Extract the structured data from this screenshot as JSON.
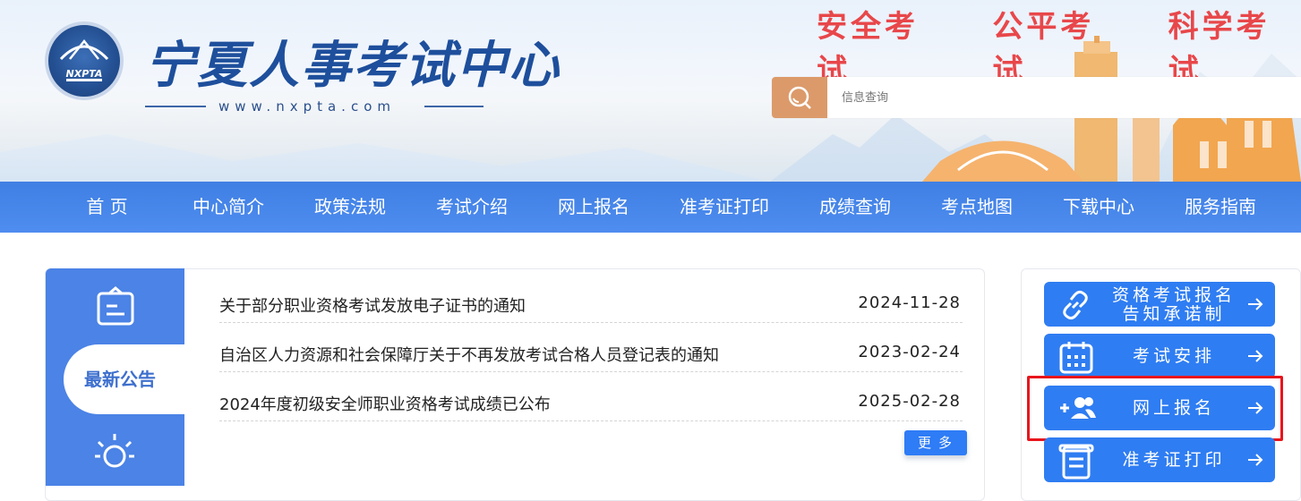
{
  "header": {
    "site_title": "宁夏人事考试中心",
    "logo_text": "NXPTA",
    "url": "www.nxpta.com",
    "slogans": [
      "安全考试",
      "公平考试",
      "科学考试"
    ],
    "search_placeholder": "信息查询",
    "search_icon": "search-icon"
  },
  "nav": {
    "items": [
      "首 页",
      "中心简介",
      "政策法规",
      "考试介绍",
      "网上报名",
      "准考证打印",
      "成绩查询",
      "考点地图",
      "下载中心",
      "服务指南"
    ]
  },
  "announcements": {
    "tab_active_label": "最新公告",
    "tab_icons": [
      "notice-board-icon",
      "lightbulb-icon"
    ],
    "items": [
      {
        "title": "关于部分职业资格考试发放电子证书的通知",
        "date": "2024-11-28"
      },
      {
        "title": "自治区人力资源和社会保障厅关于不再发放考试合格人员登记表的通知",
        "date": "2023-02-24"
      },
      {
        "title": "2024年度初级安全师职业资格考试成绩已公布",
        "date": "2025-02-28"
      }
    ],
    "more_label": "更多"
  },
  "quick_links": [
    {
      "line1": "资格考试报名",
      "line2": "告知承诺制",
      "icon": "link-icon"
    },
    {
      "line1": "考试安排",
      "icon": "calendar-icon"
    },
    {
      "line1": "网上报名",
      "icon": "add-user-icon"
    },
    {
      "line1": "准考证打印",
      "icon": "document-icon"
    }
  ],
  "colors": {
    "nav_blue": "#4a88ec",
    "slogan_red": "#e8474a",
    "button_blue": "#2f7df2",
    "search_orange": "#dc9a6a",
    "highlight_red": "#e8151c"
  }
}
